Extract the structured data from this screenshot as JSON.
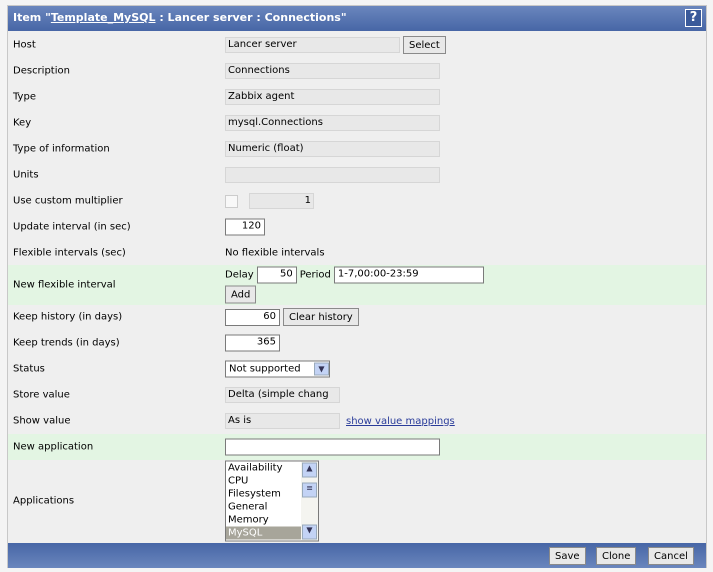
{
  "header": {
    "prefix": "Item \"",
    "template_link": "Template_MySQL",
    "suffix": " : Lancer server : Connections\"",
    "help": "?"
  },
  "form": {
    "host": {
      "label": "Host",
      "value": "Lancer server",
      "button": "Select"
    },
    "description": {
      "label": "Description",
      "value": "Connections"
    },
    "type": {
      "label": "Type",
      "value": "Zabbix agent"
    },
    "key": {
      "label": "Key",
      "value": "mysql.Connections"
    },
    "type_of_information": {
      "label": "Type of information",
      "value": "Numeric (float)"
    },
    "units": {
      "label": "Units",
      "value": ""
    },
    "multiplier": {
      "label": "Use custom multiplier",
      "checked": false,
      "value": "1"
    },
    "update_interval": {
      "label": "Update interval (in sec)",
      "value": "120"
    },
    "flexible_intervals": {
      "label": "Flexible intervals (sec)",
      "value": "No flexible intervals"
    },
    "new_flexible": {
      "label": "New flexible interval",
      "delay_label": "Delay",
      "delay": "50",
      "period_label": "Period",
      "period": "1-7,00:00-23:59",
      "add": "Add"
    },
    "keep_history": {
      "label": "Keep history (in days)",
      "value": "60",
      "button": "Clear history"
    },
    "keep_trends": {
      "label": "Keep trends (in days)",
      "value": "365"
    },
    "status": {
      "label": "Status",
      "value": "Not supported"
    },
    "store_value": {
      "label": "Store value",
      "value": "Delta (simple chang"
    },
    "show_value": {
      "label": "Show value",
      "value": "As is",
      "link": "show value mappings"
    },
    "new_application": {
      "label": "New application",
      "value": ""
    },
    "applications": {
      "label": "Applications",
      "items": [
        "Availability",
        "CPU",
        "Filesystem",
        "General",
        "Memory",
        "MySQL"
      ],
      "selected": "MySQL"
    }
  },
  "footer": {
    "save": "Save",
    "clone": "Clone",
    "cancel": "Cancel"
  }
}
